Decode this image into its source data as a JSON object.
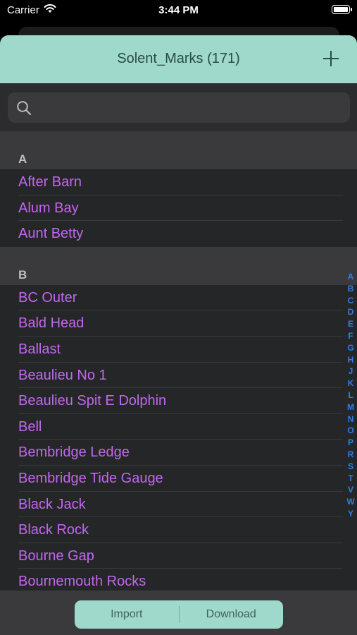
{
  "status_bar": {
    "carrier": "Carrier",
    "time": "3:44 PM"
  },
  "nav": {
    "title": "Solent_Marks (171)"
  },
  "search": {
    "placeholder": ""
  },
  "sections": [
    {
      "letter": "A",
      "items": [
        "After Barn",
        "Alum Bay",
        "Aunt Betty"
      ]
    },
    {
      "letter": "B",
      "items": [
        "BC Outer",
        "Bald Head",
        "Ballast",
        "Beaulieu No 1",
        "Beaulieu Spit E Dolphin",
        "Bell",
        "Bembridge Ledge",
        "Bembridge Tide Gauge",
        "Black Jack",
        "Black Rock",
        "Bourne Gap",
        "Bournemouth Rocks"
      ]
    }
  ],
  "index": [
    "A",
    "B",
    "C",
    "D",
    "E",
    "F",
    "G",
    "H",
    "J",
    "K",
    "L",
    "M",
    "N",
    "O",
    "P",
    "R",
    "S",
    "T",
    "V",
    "W",
    "Y"
  ],
  "toolbar": {
    "import_label": "Import",
    "download_label": "Download"
  },
  "colors": {
    "accent": "#9fd9cb",
    "item_text": "#c267f0",
    "index_text": "#2f7fe8"
  }
}
